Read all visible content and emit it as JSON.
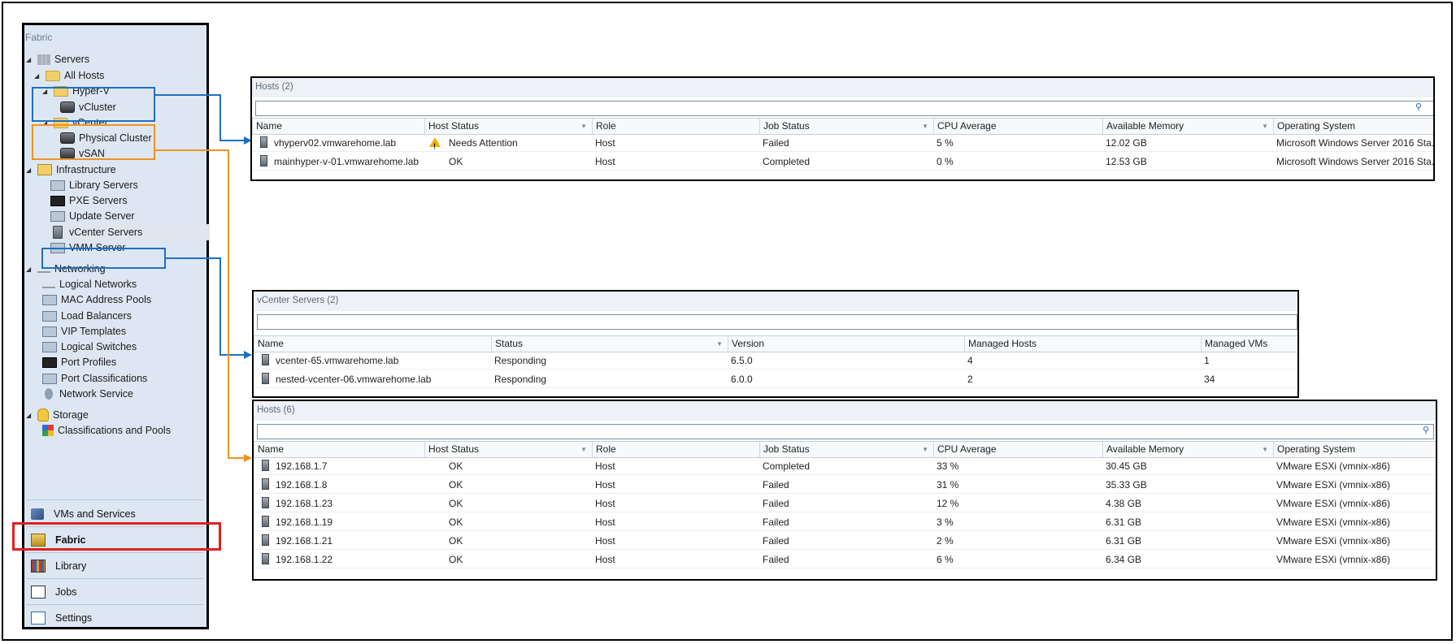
{
  "sidebar": {
    "title": "Fabric",
    "tree": [
      {
        "label": "Servers",
        "icon": "servers-icon"
      },
      {
        "label": "All Hosts",
        "icon": "folder-icon"
      },
      {
        "label": "Hyper-V",
        "icon": "folder-icon"
      },
      {
        "label": "vCluster",
        "icon": "cluster-icon"
      },
      {
        "label": "vCenter",
        "icon": "folder-icon"
      },
      {
        "label": "Physical Cluster",
        "icon": "cluster-icon"
      },
      {
        "label": "vSAN",
        "icon": "cluster-icon"
      },
      {
        "label": "Infrastructure",
        "icon": "infrastructure-icon"
      },
      {
        "label": "Library Servers",
        "icon": "library-servers-icon"
      },
      {
        "label": "PXE Servers",
        "icon": "pxe-servers-icon"
      },
      {
        "label": "Update Server",
        "icon": "update-server-icon"
      },
      {
        "label": "vCenter Servers",
        "icon": "vcenter-servers-icon"
      },
      {
        "label": "VMM Server",
        "icon": "vmm-server-icon"
      },
      {
        "label": "Networking",
        "icon": "networking-icon"
      },
      {
        "label": "Logical Networks",
        "icon": "logical-networks-icon"
      },
      {
        "label": "MAC Address Pools",
        "icon": "mac-pools-icon"
      },
      {
        "label": "Load Balancers",
        "icon": "load-balancers-icon"
      },
      {
        "label": "VIP Templates",
        "icon": "vip-templates-icon"
      },
      {
        "label": "Logical Switches",
        "icon": "logical-switches-icon"
      },
      {
        "label": "Port Profiles",
        "icon": "port-profiles-icon"
      },
      {
        "label": "Port Classifications",
        "icon": "port-classifications-icon"
      },
      {
        "label": "Network Service",
        "icon": "network-service-icon"
      },
      {
        "label": "Storage",
        "icon": "storage-icon"
      },
      {
        "label": "Classifications and Pools",
        "icon": "classifications-icon"
      }
    ],
    "workspaces": [
      {
        "label": "VMs and Services",
        "icon": "vms-services-icon"
      },
      {
        "label": "Fabric",
        "icon": "fabric-icon"
      },
      {
        "label": "Library",
        "icon": "library-icon"
      },
      {
        "label": "Jobs",
        "icon": "jobs-icon"
      },
      {
        "label": "Settings",
        "icon": "settings-icon"
      }
    ],
    "active_workspace": "Fabric",
    "selected_node": "vCenter Servers"
  },
  "hyperv_hosts": {
    "title": "Hosts (2)",
    "columns": [
      "Name",
      "Host Status",
      "Role",
      "Job Status",
      "CPU Average",
      "Available Memory",
      "Operating System"
    ],
    "rows": [
      {
        "name": "vhyperv02.vmwarehome.lab",
        "status": "Needs Attention",
        "role": "Host",
        "job": "Failed",
        "cpu": "5 %",
        "mem": "12.02 GB",
        "os": "Microsoft Windows Server 2016 Sta..."
      },
      {
        "name": "mainhyper-v-01.vmwarehome.lab",
        "status": "OK",
        "role": "Host",
        "job": "Completed",
        "cpu": "0 %",
        "mem": "12.53 GB",
        "os": "Microsoft Windows Server 2016 Sta..."
      }
    ]
  },
  "vcenter_servers": {
    "title": "vCenter Servers (2)",
    "columns": [
      "Name",
      "Status",
      "Version",
      "Managed Hosts",
      "Managed VMs"
    ],
    "rows": [
      {
        "name": "vcenter-65.vmwarehome.lab",
        "status": "Responding",
        "version": "6.5.0",
        "hosts": "4",
        "vms": "1"
      },
      {
        "name": "nested-vcenter-06.vmwarehome.lab",
        "status": "Responding",
        "version": "6.0.0",
        "hosts": "2",
        "vms": "34"
      }
    ]
  },
  "vcenter_hosts": {
    "title": "Hosts (6)",
    "columns": [
      "Name",
      "Host Status",
      "Role",
      "Job Status",
      "CPU Average",
      "Available Memory",
      "Operating System"
    ],
    "rows": [
      {
        "name": "192.168.1.7",
        "status": "OK",
        "role": "Host",
        "job": "Completed",
        "cpu": "33 %",
        "mem": "30.45 GB",
        "os": "VMware ESXi (vmnix-x86)"
      },
      {
        "name": "192.168.1.8",
        "status": "OK",
        "role": "Host",
        "job": "Failed",
        "cpu": "31 %",
        "mem": "35.33 GB",
        "os": "VMware ESXi (vmnix-x86)"
      },
      {
        "name": "192.168.1.23",
        "status": "OK",
        "role": "Host",
        "job": "Failed",
        "cpu": "12 %",
        "mem": "4.38 GB",
        "os": "VMware ESXi (vmnix-x86)"
      },
      {
        "name": "192.168.1.19",
        "status": "OK",
        "role": "Host",
        "job": "Failed",
        "cpu": "3 %",
        "mem": "6.31 GB",
        "os": "VMware ESXi (vmnix-x86)"
      },
      {
        "name": "192.168.1.21",
        "status": "OK",
        "role": "Host",
        "job": "Failed",
        "cpu": "2 %",
        "mem": "6.31 GB",
        "os": "VMware ESXi (vmnix-x86)"
      },
      {
        "name": "192.168.1.22",
        "status": "OK",
        "role": "Host",
        "job": "Failed",
        "cpu": "6 %",
        "mem": "6.34 GB",
        "os": "VMware ESXi (vmnix-x86)"
      }
    ]
  },
  "colors": {
    "hyperv_highlight": "#1f6fc5",
    "vcenter_highlight": "#f0931e",
    "vcenter_servers_highlight": "#1f6fc5",
    "fabric_highlight": "#e02020"
  }
}
